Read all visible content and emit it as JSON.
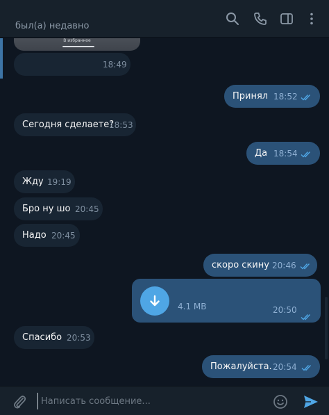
{
  "header": {
    "status": "был(а) недавно",
    "icons": [
      "search-icon",
      "phone-icon",
      "sidebar-toggle-icon",
      "more-vertical-icon"
    ]
  },
  "messages": [
    {
      "dir": "in",
      "kind": "image-caption",
      "image_caption": "В избранное",
      "time": "18:49"
    },
    {
      "dir": "out",
      "text": "Принял",
      "time": "18:52",
      "read": true
    },
    {
      "dir": "in",
      "text": "Сегодня сделаете?",
      "time": "18:53"
    },
    {
      "dir": "out",
      "text": "Да",
      "time": "18:54",
      "read": true
    },
    {
      "dir": "in",
      "text": "Жду",
      "time": "19:19"
    },
    {
      "dir": "in",
      "text": "Бро ну шо",
      "time": "20:45"
    },
    {
      "dir": "in",
      "text": "Надо",
      "time": "20:45"
    },
    {
      "dir": "out",
      "text": "скоро скину",
      "time": "20:46",
      "read": true
    },
    {
      "dir": "out",
      "kind": "file",
      "size": "4.1 MB",
      "time": "20:50",
      "read": true
    },
    {
      "dir": "in",
      "text": "Спасибо",
      "time": "20:53"
    },
    {
      "dir": "out",
      "text": "Пожалуйста.",
      "time": "20:54",
      "read": true
    }
  ],
  "composer": {
    "placeholder": "Написать сообщение...",
    "icons": [
      "paperclip-icon",
      "emoji-icon",
      "send-icon"
    ]
  },
  "colors": {
    "background": "#0e1621",
    "header": "#17212b",
    "incoming_bubble": "#182533",
    "outgoing_bubble": "#2b5278",
    "accent": "#4fa6e5"
  }
}
